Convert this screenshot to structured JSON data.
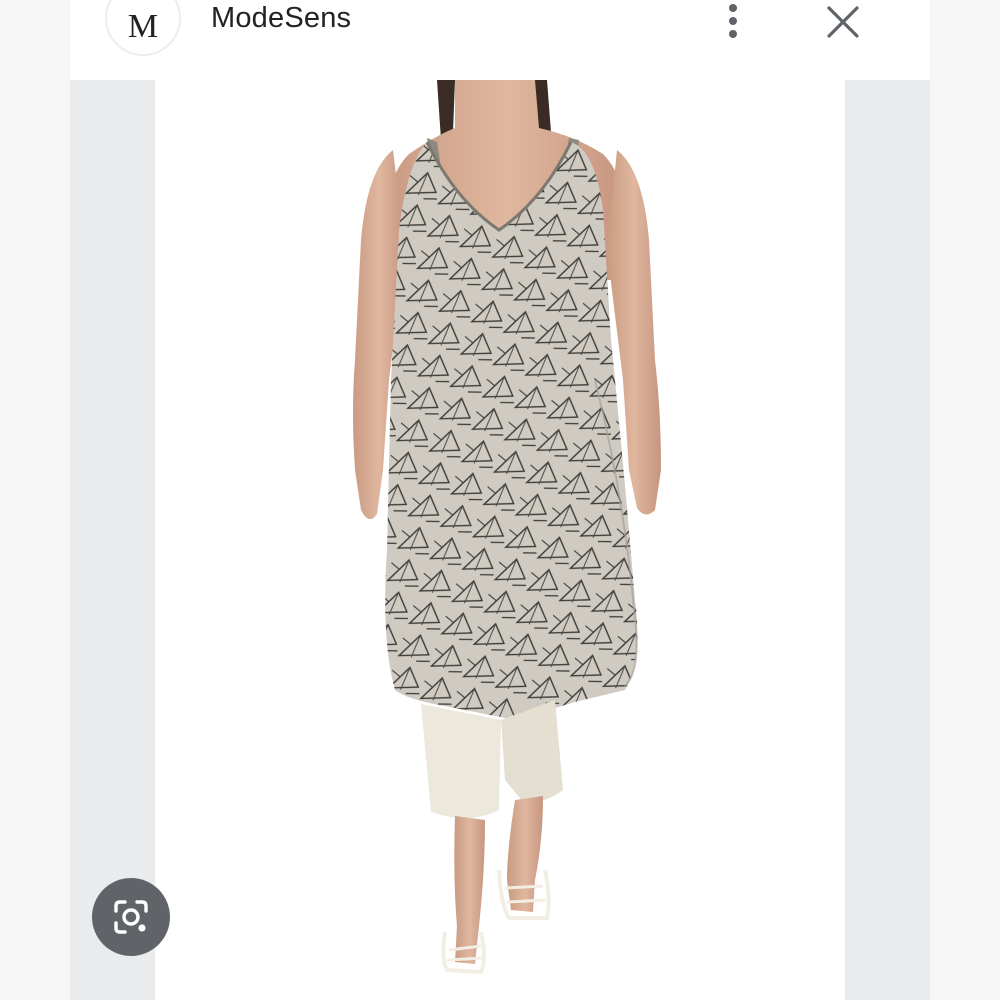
{
  "header": {
    "site_initial": "M",
    "site_name": "ModeSens",
    "more_icon": "more-vertical-icon",
    "close_icon": "close-icon"
  },
  "image": {
    "subject": "product-photo",
    "dress_color": "#b9b4aa",
    "pants_color": "#ece8dc"
  },
  "lens": {
    "icon": "lens-search-icon"
  },
  "colors": {
    "header_bg": "#ffffff",
    "frame_bg": "#e9ebed",
    "lens_bg": "#606368",
    "icon_gray": "#5f6368"
  }
}
